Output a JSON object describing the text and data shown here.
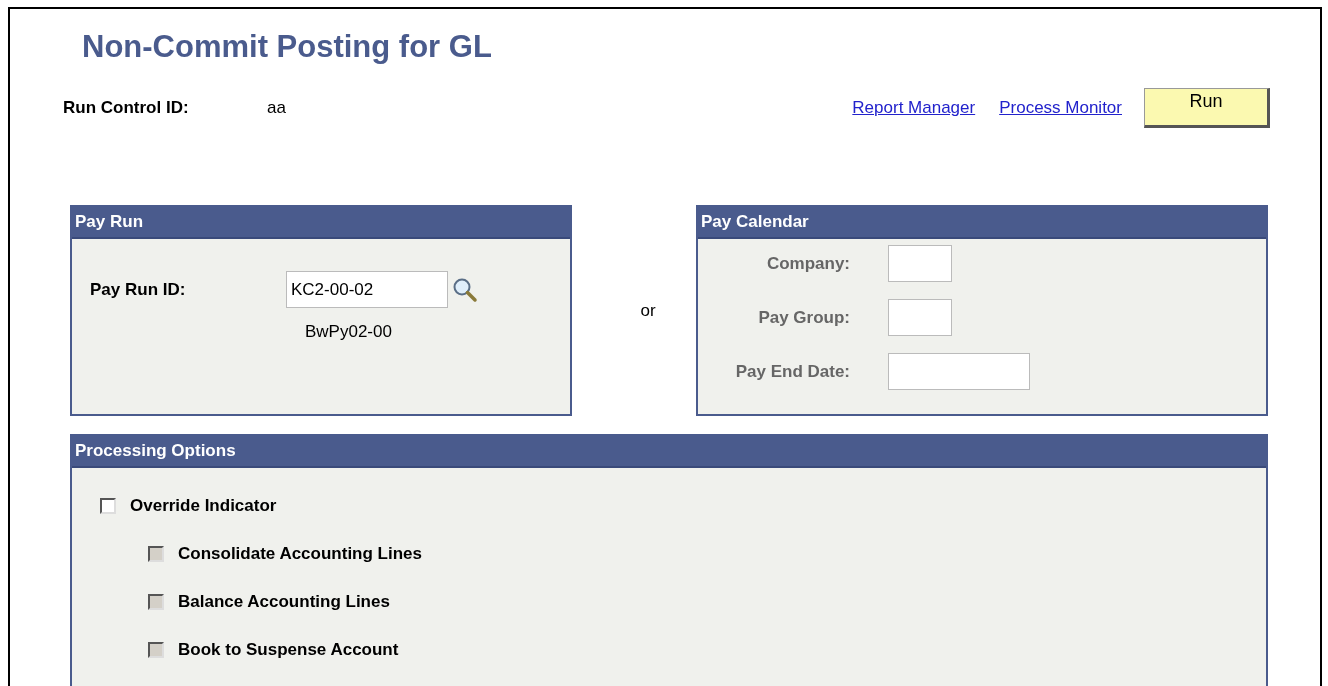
{
  "title": "Non-Commit Posting for GL",
  "run_control": {
    "label": "Run Control ID:",
    "value": "aa"
  },
  "links": [
    "Report Manager",
    "Process Monitor"
  ],
  "run_button": "Run",
  "pay_run": {
    "title": "Pay Run",
    "field_label": "Pay Run ID:",
    "field_value": "KC2-00-02",
    "description": "BwPy02-00"
  },
  "separator": "or",
  "pay_calendar": {
    "title": "Pay Calendar",
    "disabled": true,
    "fields": [
      {
        "label": "Company:",
        "kind": "code"
      },
      {
        "label": "Pay Group:",
        "kind": "code"
      },
      {
        "label": "Pay End Date:",
        "kind": "date"
      }
    ]
  },
  "processing_options": {
    "title": "Processing Options",
    "options": [
      {
        "label": "Override Indicator",
        "checked": false,
        "disabled": false,
        "children": [
          {
            "label": "Consolidate Accounting Lines",
            "checked": false,
            "disabled": true
          },
          {
            "label": "Balance Accounting Lines",
            "checked": false,
            "disabled": true
          },
          {
            "label": "Book to Suspense Account",
            "checked": false,
            "disabled": true
          }
        ]
      }
    ]
  }
}
